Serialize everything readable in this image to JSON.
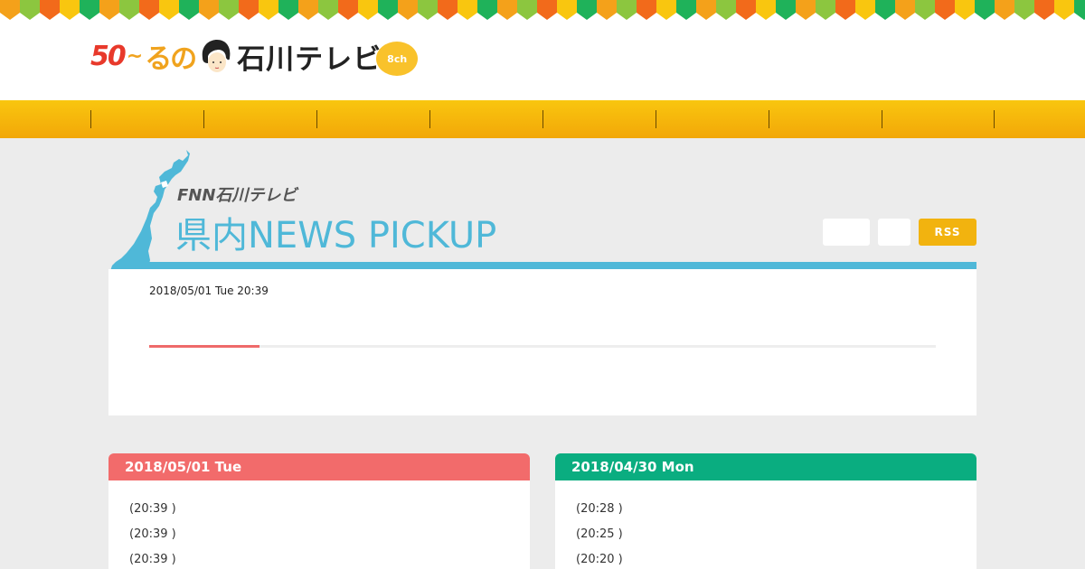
{
  "brand": {
    "logo_50": "50",
    "logo_tilde": "~",
    "logo_runo": "るの",
    "logo_name": "石川テレビ",
    "logo_channel": "8ch",
    "colors": {
      "red": "#e8392b",
      "orange": "#f0a31e",
      "yellow": "#f9c22b",
      "dark": "#222222"
    }
  },
  "bunting_colors": [
    "#f4a11a",
    "#8cc63f",
    "#f26a1b",
    "#f9c60f",
    "#1fb25a"
  ],
  "nav": {
    "items": [
      "",
      "",
      "",
      "",
      "",
      "",
      "",
      "",
      ""
    ],
    "colors": {
      "top": "#f9c60f",
      "bottom": "#f2a708"
    }
  },
  "news": {
    "fnn_label": "FNN石川テレビ",
    "title": "県内NEWS  PICKUP",
    "buttons": [
      "",
      ""
    ],
    "rss_label": "RSS",
    "date": "2018/05/01 Tue 20:39",
    "progress": 0.14,
    "colors": {
      "accent": "#4fb8d8",
      "progress": "#ef6a6a",
      "rss": "#f2b30f"
    }
  },
  "days": [
    {
      "date_label": "2018/05/01 Tue",
      "color": "#f26b6b",
      "items": [
        {
          "time": "(20:39 )"
        },
        {
          "time": "(20:39 )"
        },
        {
          "time": "(20:39 )"
        }
      ]
    },
    {
      "date_label": "2018/04/30 Mon",
      "color": "#0aad80",
      "items": [
        {
          "time": "(20:28 )"
        },
        {
          "time": "(20:25 )"
        },
        {
          "time": "(20:20 )"
        }
      ]
    }
  ]
}
